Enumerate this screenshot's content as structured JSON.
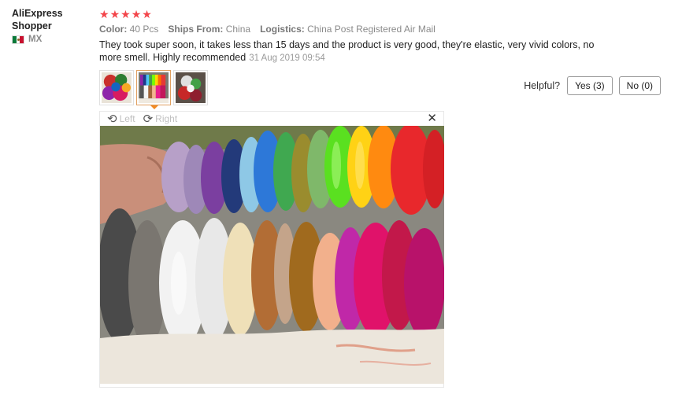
{
  "reviewer": {
    "name": "AliExpress Shopper",
    "country_code": "MX"
  },
  "review": {
    "rating": 5,
    "attributes": [
      {
        "label": "Color:",
        "value": "40 Pcs"
      },
      {
        "label": "Ships From:",
        "value": "China"
      },
      {
        "label": "Logistics:",
        "value": "China Post Registered Air Mail"
      }
    ],
    "text": "They took super soon, it takes less than 15 days and the product is very good, they're elastic, very vivid colors, no more smell. Highly recommended",
    "date": "31 Aug 2019 09:54"
  },
  "helpful": {
    "label": "Helpful?",
    "yes_label": "Yes (3)",
    "no_label": "No (0)"
  },
  "viewer": {
    "rotate_left": "Left",
    "rotate_right": "Right",
    "close_icon": "close-icon"
  },
  "thumbnails": [
    {
      "selected": false
    },
    {
      "selected": true
    },
    {
      "selected": false
    }
  ]
}
